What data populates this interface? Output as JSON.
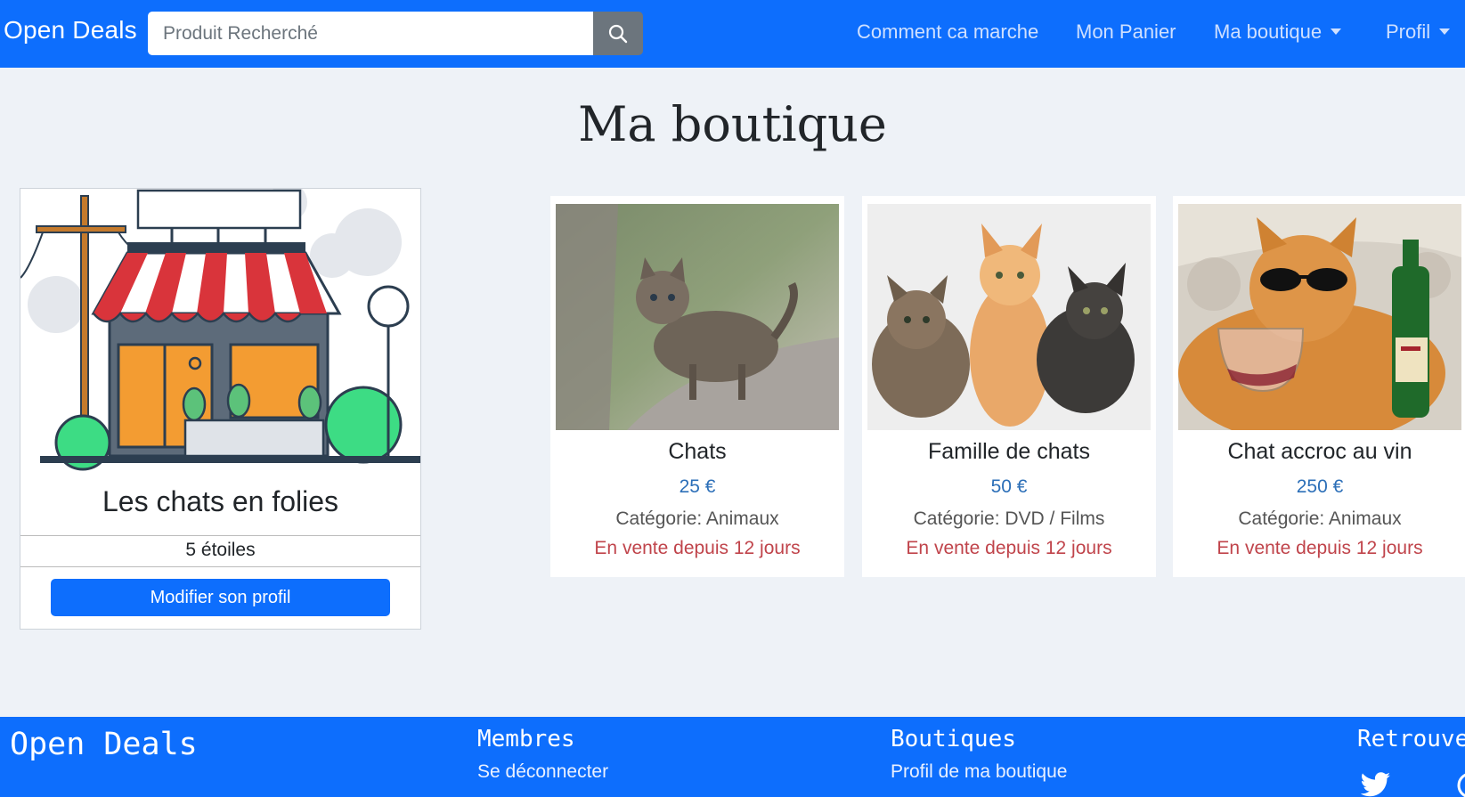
{
  "nav": {
    "brand": "Open Deals",
    "search_placeholder": "Produit Recherché",
    "links": [
      "Comment ca marche",
      "Mon Panier",
      "Ma boutique",
      "Profil"
    ]
  },
  "title": "Ma boutique",
  "shop": {
    "name": "Les chats en folies",
    "rating_text": "5 étoiles",
    "edit_button": "Modifier son profil"
  },
  "products": [
    {
      "name": "Chats",
      "price": "25 €",
      "category": "Catégorie: Animaux",
      "since": "En vente depuis 12 jours"
    },
    {
      "name": "Famille de chats",
      "price": "50 €",
      "category": "Catégorie: DVD / Films",
      "since": "En vente depuis 12 jours"
    },
    {
      "name": "Chat accroc au vin",
      "price": "250 €",
      "category": "Catégorie: Animaux",
      "since": "En vente depuis 12 jours"
    }
  ],
  "footer": {
    "brand": "Open Deals",
    "members_title": "Membres",
    "members_link": "Se déconnecter",
    "shops_title": "Boutiques",
    "shops_link": "Profil de ma boutique",
    "find_title": "Retrouvez-nous"
  },
  "colors": {
    "primary": "#0d6efd",
    "price": "#2c6fb8",
    "since": "#c0444b"
  }
}
